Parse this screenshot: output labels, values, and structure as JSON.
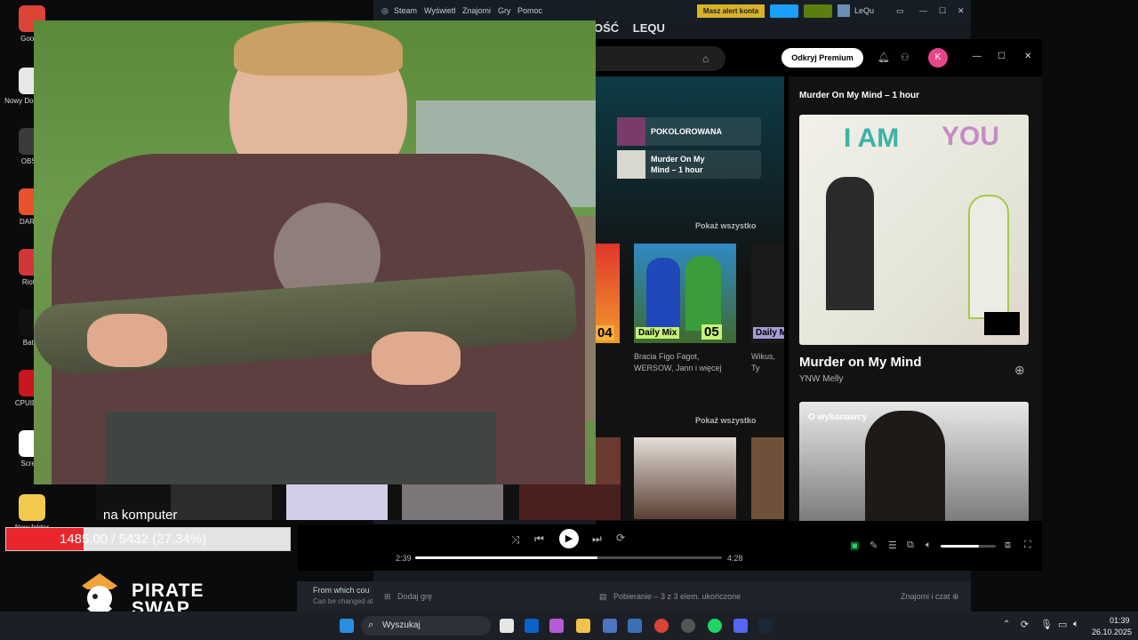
{
  "desktop": {
    "icons": [
      {
        "label": "Google",
        "color": "#db4437"
      },
      {
        "label": "Nowy Do tekstow",
        "color": "#e8e8e8"
      },
      {
        "label": "OBS S",
        "color": "#3a3a3a"
      },
      {
        "label": "DAREU",
        "color": "#e8522d"
      },
      {
        "label": "Riot C",
        "color": "#d13639"
      },
      {
        "label": "Battle",
        "color": "#111111"
      },
      {
        "label": "CPUID HV",
        "color": "#c9151e"
      },
      {
        "label": "Screen",
        "color": "#ffffff"
      },
      {
        "label": "New folder",
        "color": "#f2c94c"
      }
    ]
  },
  "steam": {
    "menu": [
      "Steam",
      "Wyświetl",
      "Znajomi",
      "Gry",
      "Pomoc"
    ],
    "alert_button": "Masz alert konta",
    "username": "LeQu",
    "nav": [
      "OŚĆ",
      "LEQU"
    ],
    "bottom": {
      "add_game": "Dodaj grę",
      "downloads": "Pobieranie – 3 z 3 elem. ukończone",
      "friends": "Znajomi i czat"
    },
    "from_which": "From which cou",
    "can_be_changed": "Can be changed at"
  },
  "spotify": {
    "premium_button": "Odkryj Premium",
    "avatar_letter": "K",
    "playlists": [
      "POKOLOROWANA",
      "Murder On My Mind – 1 hour"
    ],
    "show_all_1": "Pokaż wszystko",
    "show_all_2": "Pokaż wszystko",
    "daily_mix": {
      "label": "Daily Mix",
      "number": "05",
      "number_left": "04",
      "artists": "Bracia Figo Fagot, WERSOW, Jann i więcej",
      "artists_next": "Wikus, Ty Kanye W",
      "label_next": "Daily M"
    },
    "now_playing_header": "Murder On My Mind – 1 hour",
    "track_title": "Murder on My Mind",
    "track_artist": "YNW Melly",
    "about_artist": "O wykonawcy",
    "player": {
      "elapsed": "2:39",
      "total": "4:28",
      "progress": 0.594,
      "volume": 0.7
    }
  },
  "overlay": {
    "caption": "na komputer",
    "counter": "1485.00 / 5432 (27.34%)",
    "counter_fraction": 0.2734,
    "brand_line1": "PIRATE",
    "brand_line2": "SWAP"
  },
  "taskbar": {
    "search": "Wyszukaj",
    "time": "01:39",
    "date": "26.10.2025"
  }
}
